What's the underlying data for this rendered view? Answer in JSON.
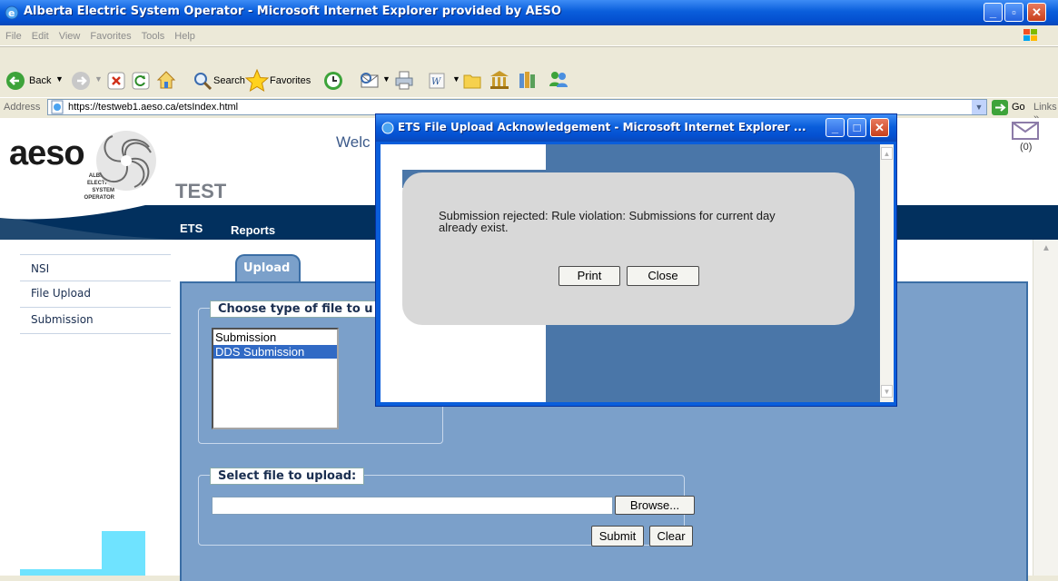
{
  "window": {
    "title": "Alberta Electric System Operator - Microsoft Internet Explorer provided by AESO"
  },
  "menu": [
    "File",
    "Edit",
    "View",
    "Favorites",
    "Tools",
    "Help"
  ],
  "toolbar": {
    "back": "Back",
    "search": "Search",
    "favorites": "Favorites"
  },
  "address": {
    "label": "Address",
    "url": "https://testweb1.aeso.ca/etsIndex.html",
    "go": "Go",
    "links": "Links"
  },
  "site": {
    "logo": "aeso",
    "logo_sub": [
      "ALBERTA",
      "ELECTRIC",
      "SYSTEM",
      "OPERATOR"
    ],
    "env": "TEST",
    "welcome": "Welc",
    "mail_count": "(0)",
    "nav": [
      "ETS",
      "Reports"
    ],
    "sidebar": [
      "NSI",
      "File Upload",
      "Submission"
    ],
    "tab": "Upload",
    "choose_legend": "Choose type of file to u",
    "file_types": [
      "Submission",
      "DDS Submission"
    ],
    "selected_type": "DDS Submission",
    "select_legend": "Select file to upload:",
    "browse": "Browse...",
    "submit": "Submit",
    "clear": "Clear"
  },
  "popup": {
    "title": "ETS File Upload Acknowledgement - Microsoft Internet Explorer ...",
    "message": "Submission rejected: Rule violation: Submissions for current day already exist.",
    "print": "Print",
    "close": "Close"
  },
  "colors": {
    "xp_blue": "#0A5EDB",
    "header_navy": "#02305E",
    "panel_blue": "#7BA0CA",
    "popup_blue": "#4A76A8"
  }
}
